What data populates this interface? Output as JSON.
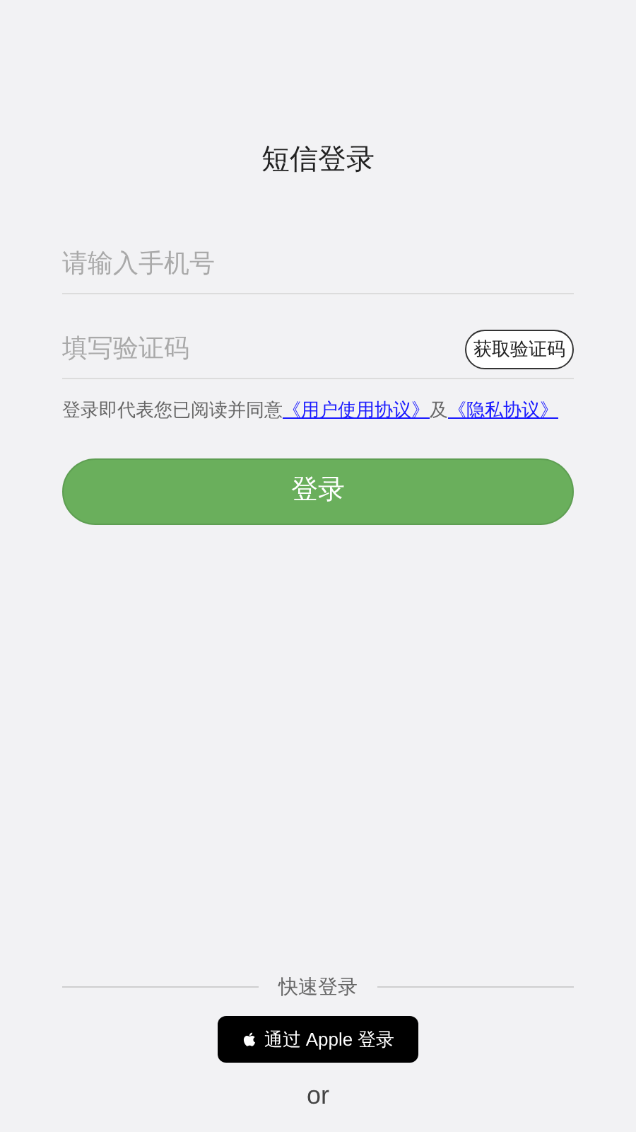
{
  "title": "短信登录",
  "phone_field": {
    "placeholder": "请输入手机号"
  },
  "code_field": {
    "placeholder": "填写验证码"
  },
  "get_code_button": "获取验证码",
  "agreement": {
    "text": "登录即代表您已阅读并同意",
    "link_1": "《用户使用协议》",
    "joiner": "及",
    "link_2": "《隐私协议》"
  },
  "login_button": "登录",
  "quick_login": {
    "label": "快速登录",
    "apple_button": "通过 Apple 登录",
    "or": "or"
  }
}
